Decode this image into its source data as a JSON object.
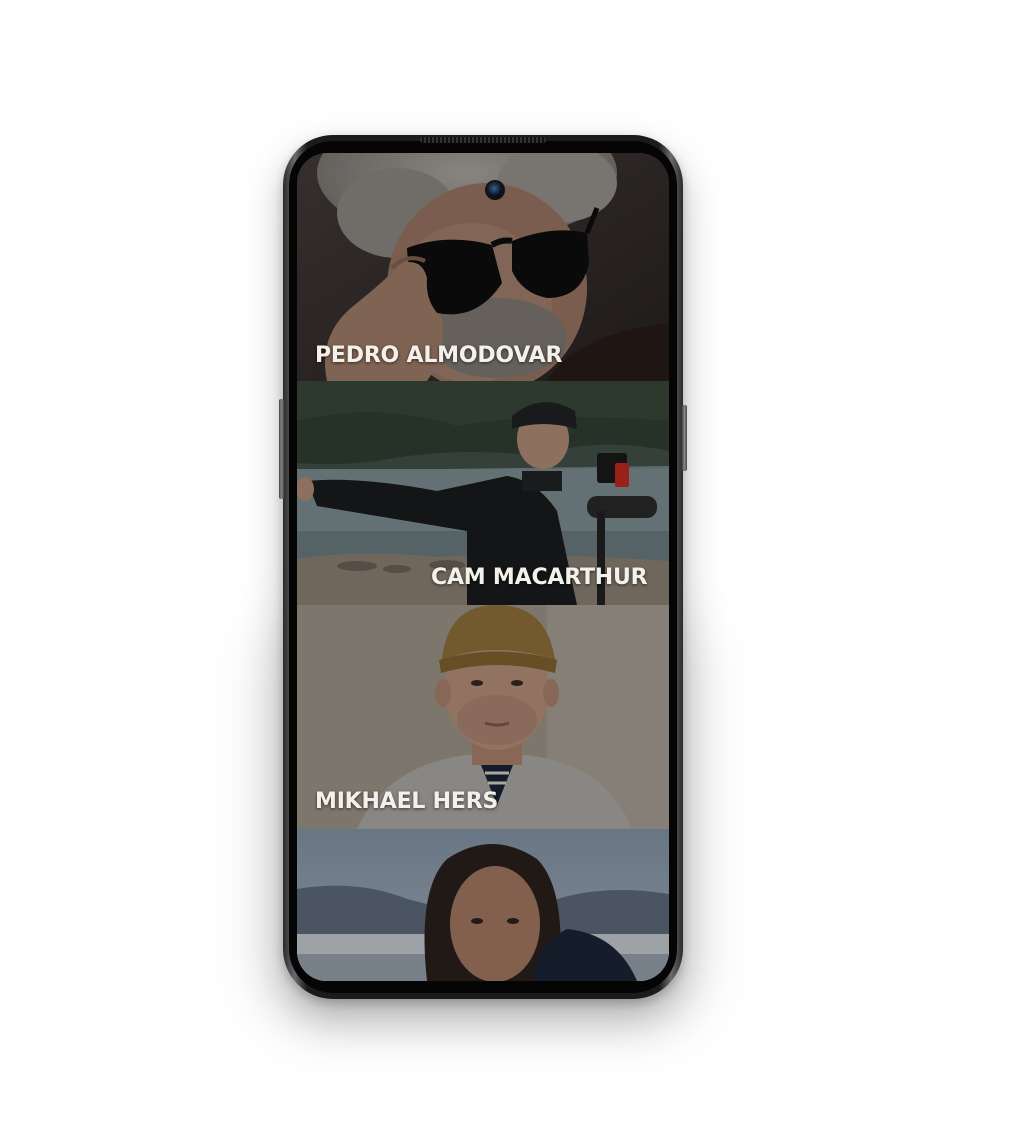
{
  "screen": {
    "cards": [
      {
        "name": "PEDRO ALMODOVAR",
        "image": "portrait-grey-hair-sunglasses"
      },
      {
        "name": "CAM MACARTHUR",
        "image": "filmmaker-with-camera-lake"
      },
      {
        "name": "MIKHAEL HERS",
        "image": "portrait-man-knit-hat"
      },
      {
        "name": "",
        "image": "portrait-woman-winter-landscape"
      }
    ]
  },
  "colors": {
    "background": "#ffffff",
    "phone_frame": "#1b1b1d",
    "name_text": "#f4f1ea"
  }
}
